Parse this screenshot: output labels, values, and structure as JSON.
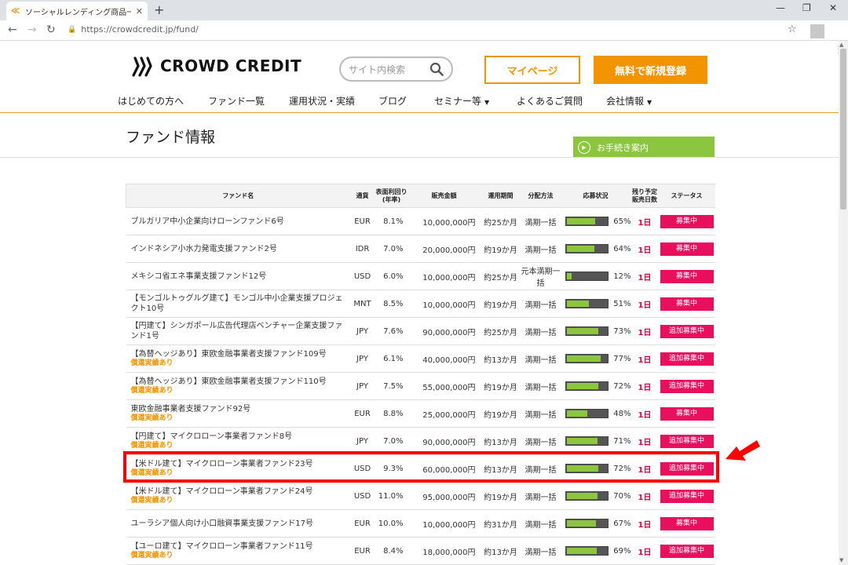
{
  "browser": {
    "tab_title": "ソーシャルレンディング商品一覧：商",
    "url": "https://crowdcredit.jp/fund/"
  },
  "site": {
    "logo_text": "CROWD CREDIT",
    "search_placeholder": "サイト内検索",
    "mypage_label": "マイページ",
    "register_label": "無料で新規登録",
    "nav": [
      {
        "label": "はじめての方へ",
        "dropdown": false
      },
      {
        "label": "ファンド一覧",
        "dropdown": false
      },
      {
        "label": "運用状況・実績",
        "dropdown": false
      },
      {
        "label": "ブログ",
        "dropdown": false
      },
      {
        "label": "セミナー等",
        "dropdown": true
      },
      {
        "label": "よくあるご質問",
        "dropdown": false
      },
      {
        "label": "会社情報",
        "dropdown": true
      }
    ],
    "accent_color": "#f29400"
  },
  "page": {
    "title": "ファンド情報",
    "procedure_label": "お手続き案内"
  },
  "table": {
    "headers": [
      "ファンド名",
      "通貨",
      "表面利回り\n(年率)",
      "販売金額",
      "運用期間",
      "分配方法",
      "応募状況",
      "残り予定\n販売日数",
      "ステータス"
    ],
    "rows": [
      {
        "name": "ブルガリア中小企業向けローンファンド6号",
        "note": "",
        "currency": "EUR",
        "yield": "8.1%",
        "amount": "10,000,000円",
        "term": "約25か月",
        "method": "満期一括",
        "progress": 65,
        "pct": "65%",
        "days": "1日",
        "status": "募集中"
      },
      {
        "name": "インドネシア小水力発電支援ファンド2号",
        "note": "",
        "currency": "IDR",
        "yield": "7.0%",
        "amount": "20,000,000円",
        "term": "約19か月",
        "method": "満期一括",
        "progress": 64,
        "pct": "64%",
        "days": "1日",
        "status": "募集中"
      },
      {
        "name": "メキシコ省エネ事業支援ファンド12号",
        "note": "",
        "currency": "USD",
        "yield": "6.0%",
        "amount": "10,000,000円",
        "term": "約25か月",
        "method": "元本満期一括",
        "progress": 12,
        "pct": "12%",
        "days": "1日",
        "status": "募集中"
      },
      {
        "name": "【モンゴルトゥグルグ建て】モンゴル中小企業支援プロジェクト10号",
        "note": "",
        "currency": "MNT",
        "yield": "8.5%",
        "amount": "10,000,000円",
        "term": "約19か月",
        "method": "満期一括",
        "progress": 51,
        "pct": "51%",
        "days": "1日",
        "status": "募集中"
      },
      {
        "name": "【円建て】シンガポール広告代理店ベンチャー企業支援ファンド1号",
        "note": "",
        "currency": "JPY",
        "yield": "7.6%",
        "amount": "90,000,000円",
        "term": "約25か月",
        "method": "満期一括",
        "progress": 73,
        "pct": "73%",
        "days": "1日",
        "status": "追加募集中"
      },
      {
        "name": "【為替ヘッジあり】東欧金融事業者支援ファンド109号",
        "note": "償還実績あり",
        "currency": "JPY",
        "yield": "6.1%",
        "amount": "40,000,000円",
        "term": "約13か月",
        "method": "満期一括",
        "progress": 77,
        "pct": "77%",
        "days": "1日",
        "status": "追加募集中"
      },
      {
        "name": "【為替ヘッジあり】東欧金融事業者支援ファンド110号",
        "note": "償還実績あり",
        "currency": "JPY",
        "yield": "7.5%",
        "amount": "55,000,000円",
        "term": "約19か月",
        "method": "満期一括",
        "progress": 72,
        "pct": "72%",
        "days": "1日",
        "status": "追加募集中"
      },
      {
        "name": "東欧金融事業者支援ファンド92号",
        "note": "償還実績あり",
        "currency": "EUR",
        "yield": "8.8%",
        "amount": "25,000,000円",
        "term": "約19か月",
        "method": "満期一括",
        "progress": 48,
        "pct": "48%",
        "days": "1日",
        "status": "募集中"
      },
      {
        "name": "【円建て】マイクロローン事業者ファンド8号",
        "note": "償還実績あり",
        "currency": "JPY",
        "yield": "7.0%",
        "amount": "90,000,000円",
        "term": "約13か月",
        "method": "満期一括",
        "progress": 71,
        "pct": "71%",
        "days": "1日",
        "status": "追加募集中"
      },
      {
        "name": "【米ドル建て】マイクロローン事業者ファンド23号",
        "note": "償還実績あり",
        "currency": "USD",
        "yield": "9.3%",
        "amount": "60,000,000円",
        "term": "約13か月",
        "method": "満期一括",
        "progress": 72,
        "pct": "72%",
        "days": "1日",
        "status": "追加募集中"
      },
      {
        "name": "【米ドル建て】マイクロローン事業者ファンド24号",
        "note": "償還実績あり",
        "currency": "USD",
        "yield": "11.0%",
        "amount": "95,000,000円",
        "term": "約19か月",
        "method": "満期一括",
        "progress": 70,
        "pct": "70%",
        "days": "1日",
        "status": "追加募集中"
      },
      {
        "name": "ユーラシア個人向け小口融資事業支援ファンド17号",
        "note": "",
        "currency": "EUR",
        "yield": "10.0%",
        "amount": "10,000,000円",
        "term": "約31か月",
        "method": "満期一括",
        "progress": 67,
        "pct": "67%",
        "days": "1日",
        "status": "募集中"
      },
      {
        "name": "【ユーロ建て】マイクロローン事業者ファンド11号",
        "note": "償還実績あり",
        "currency": "EUR",
        "yield": "8.4%",
        "amount": "18,000,000円",
        "term": "約13か月",
        "method": "満期一括",
        "progress": 69,
        "pct": "69%",
        "days": "1日",
        "status": "追加募集中"
      }
    ]
  }
}
